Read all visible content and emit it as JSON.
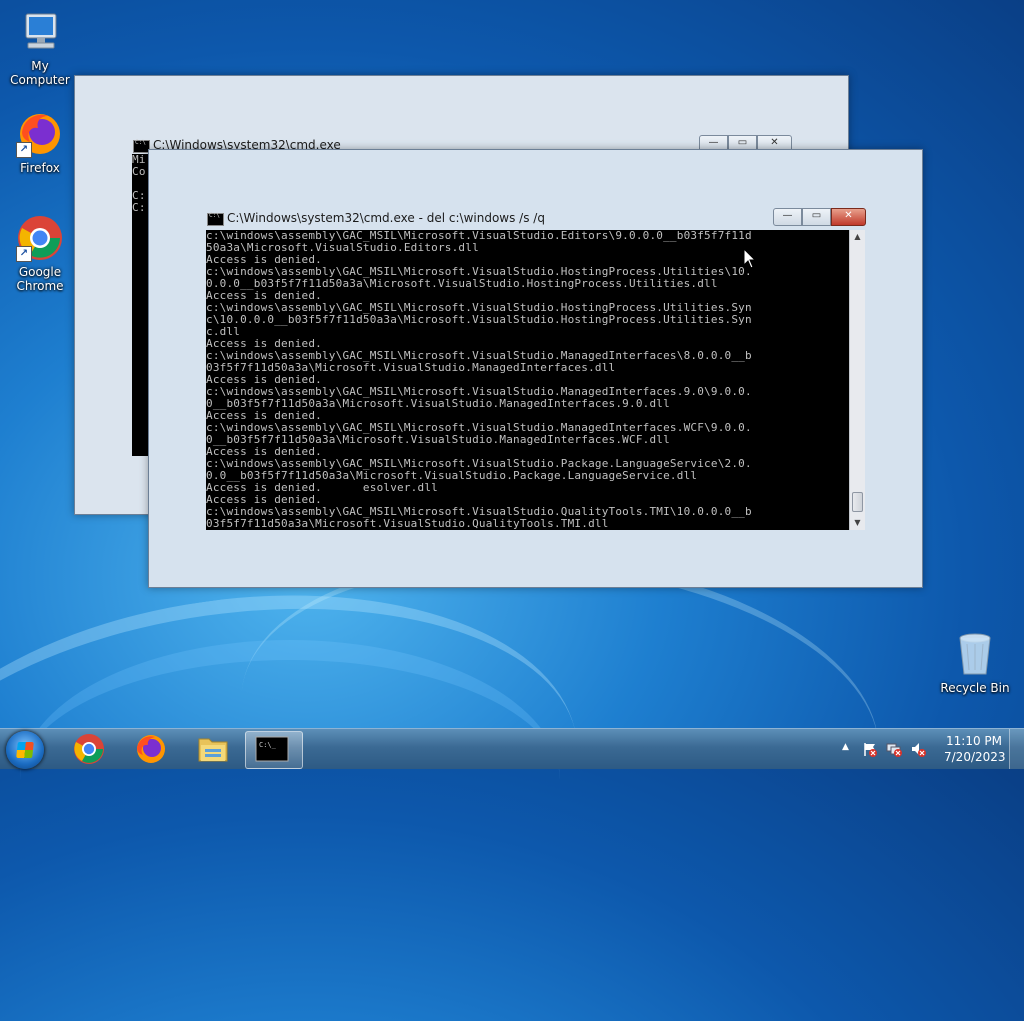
{
  "desktop": {
    "icons": [
      {
        "label": "My Computer"
      },
      {
        "label": "Firefox"
      },
      {
        "label": "Google Chrome"
      },
      {
        "label": "Recycle Bin"
      }
    ]
  },
  "back_window": {
    "title": "C:\\Windows\\system32\\cmd.exe",
    "console_text": "Mi\nCo\n\nC:\nC:"
  },
  "front_window": {
    "title": "C:\\Windows\\system32\\cmd.exe - del  c:\\windows /s /q",
    "console_lines": [
      "c:\\windows\\assembly\\GAC_MSIL\\Microsoft.VisualStudio.Editors\\9.0.0.0__b03f5f7f11d",
      "50a3a\\Microsoft.VisualStudio.Editors.dll",
      "Access is denied.",
      "c:\\windows\\assembly\\GAC_MSIL\\Microsoft.VisualStudio.HostingProcess.Utilities\\10.",
      "0.0.0__b03f5f7f11d50a3a\\Microsoft.VisualStudio.HostingProcess.Utilities.dll",
      "Access is denied.",
      "c:\\windows\\assembly\\GAC_MSIL\\Microsoft.VisualStudio.HostingProcess.Utilities.Syn",
      "c\\10.0.0.0__b03f5f7f11d50a3a\\Microsoft.VisualStudio.HostingProcess.Utilities.Syn",
      "c.dll",
      "Access is denied.",
      "c:\\windows\\assembly\\GAC_MSIL\\Microsoft.VisualStudio.ManagedInterfaces\\8.0.0.0__b",
      "03f5f7f11d50a3a\\Microsoft.VisualStudio.ManagedInterfaces.dll",
      "Access is denied.",
      "c:\\windows\\assembly\\GAC_MSIL\\Microsoft.VisualStudio.ManagedInterfaces.9.0\\9.0.0.",
      "0__b03f5f7f11d50a3a\\Microsoft.VisualStudio.ManagedInterfaces.9.0.dll",
      "Access is denied.",
      "c:\\windows\\assembly\\GAC_MSIL\\Microsoft.VisualStudio.ManagedInterfaces.WCF\\9.0.0.",
      "0__b03f5f7f11d50a3a\\Microsoft.VisualStudio.ManagedInterfaces.WCF.dll",
      "Access is denied.",
      "c:\\windows\\assembly\\GAC_MSIL\\Microsoft.VisualStudio.Package.LanguageService\\2.0.",
      "0.0__b03f5f7f11d50a3a\\Microsoft.VisualStudio.Package.LanguageService.dll",
      "Access is denied.      esolver.dll",
      "Access is denied.",
      "c:\\windows\\assembly\\GAC_MSIL\\Microsoft.VisualStudio.QualityTools.TMI\\10.0.0.0__b",
      "03f5f7f11d50a3a\\Microsoft.VisualStudio.QualityTools.TMI.dll"
    ]
  },
  "taskbar": {
    "clock_time": "11:10 PM",
    "clock_date": "7/20/2023",
    "tray_up_arrow": "▲"
  },
  "window_buttons": {
    "minimize": "—",
    "maximize": "▭",
    "close": "✕"
  },
  "scrollbar": {
    "up": "▲",
    "down": "▼"
  }
}
